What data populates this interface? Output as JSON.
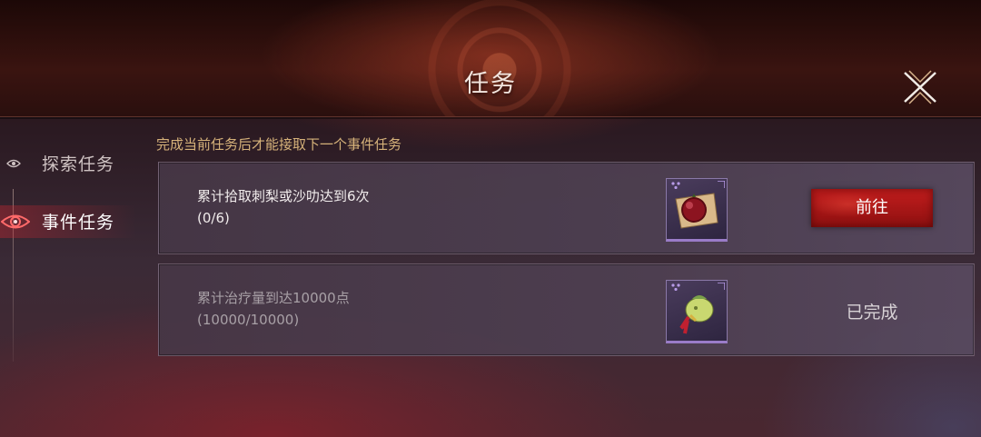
{
  "header": {
    "title": "任务"
  },
  "sidebar": {
    "tabs": [
      {
        "label": "探索任务",
        "active": false
      },
      {
        "label": "事件任务",
        "active": true
      }
    ]
  },
  "notice": "完成当前任务后才能接取下一个事件任务",
  "quests": [
    {
      "name": "累计拾取刺梨或沙叻达到6次",
      "progress": "(0/6)",
      "reward_icon": "berry-on-parchment-icon",
      "action_label": "前往",
      "completed": false
    },
    {
      "name": "累计治疗量到达10000点",
      "progress": "(10000/10000)",
      "reward_icon": "herb-pouch-icon",
      "status_label": "已完成",
      "completed": true
    }
  ],
  "colors": {
    "accent_red": "#c21d1d",
    "notice_gold": "#d6b27a",
    "rare_purple": "#9a7cc8"
  }
}
